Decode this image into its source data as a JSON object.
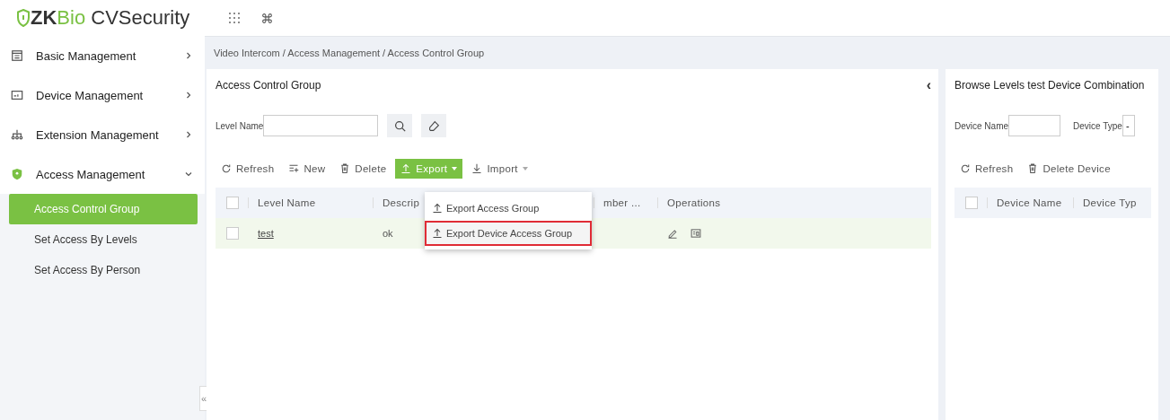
{
  "header": {
    "logo_brand": "ZKBio",
    "logo_product": " CVSecurity"
  },
  "sidebar": {
    "items": [
      {
        "label": "Basic Management",
        "expanded": false
      },
      {
        "label": "Device Management",
        "expanded": false
      },
      {
        "label": "Extension Management",
        "expanded": false
      },
      {
        "label": "Access Management",
        "expanded": true,
        "children": [
          {
            "label": "Access Control Group",
            "selected": true
          },
          {
            "label": "Set Access By Levels",
            "selected": false
          },
          {
            "label": "Set Access By Person",
            "selected": false
          }
        ]
      }
    ],
    "collapse": "«"
  },
  "breadcrumb": "Video Intercom / Access Management / Access Control Group",
  "left_panel": {
    "title": "Access Control Group",
    "collapse": "‹",
    "filter": {
      "label": "Level Name"
    },
    "toolbar": [
      {
        "label": "Refresh",
        "kind": "plain"
      },
      {
        "label": "New",
        "kind": "plain"
      },
      {
        "label": "Delete",
        "kind": "plain"
      },
      {
        "label": "Export",
        "kind": "primary-menu"
      },
      {
        "label": "Import",
        "kind": "menu"
      }
    ],
    "export_menu": [
      {
        "label": "Export Access Group",
        "selected": false
      },
      {
        "label": "Export Device Access Group",
        "selected": true
      }
    ],
    "table": {
      "header_checked": false,
      "columns": [
        "Level Name",
        "Descrip",
        "mber ...",
        "Operations"
      ],
      "rows": [
        {
          "checked": false,
          "cells": [
            "test",
            "ok"
          ]
        }
      ]
    }
  },
  "right_panel": {
    "title": "Browse Levels test Device Combination",
    "filters": [
      {
        "label": "Device Name"
      },
      {
        "label": "Device Type",
        "value": "-"
      }
    ],
    "toolbar": [
      {
        "label": "Refresh"
      },
      {
        "label": "Delete Device"
      }
    ],
    "table": {
      "header_checked": false,
      "columns": [
        "Device Name",
        "Device Typ"
      ]
    }
  }
}
